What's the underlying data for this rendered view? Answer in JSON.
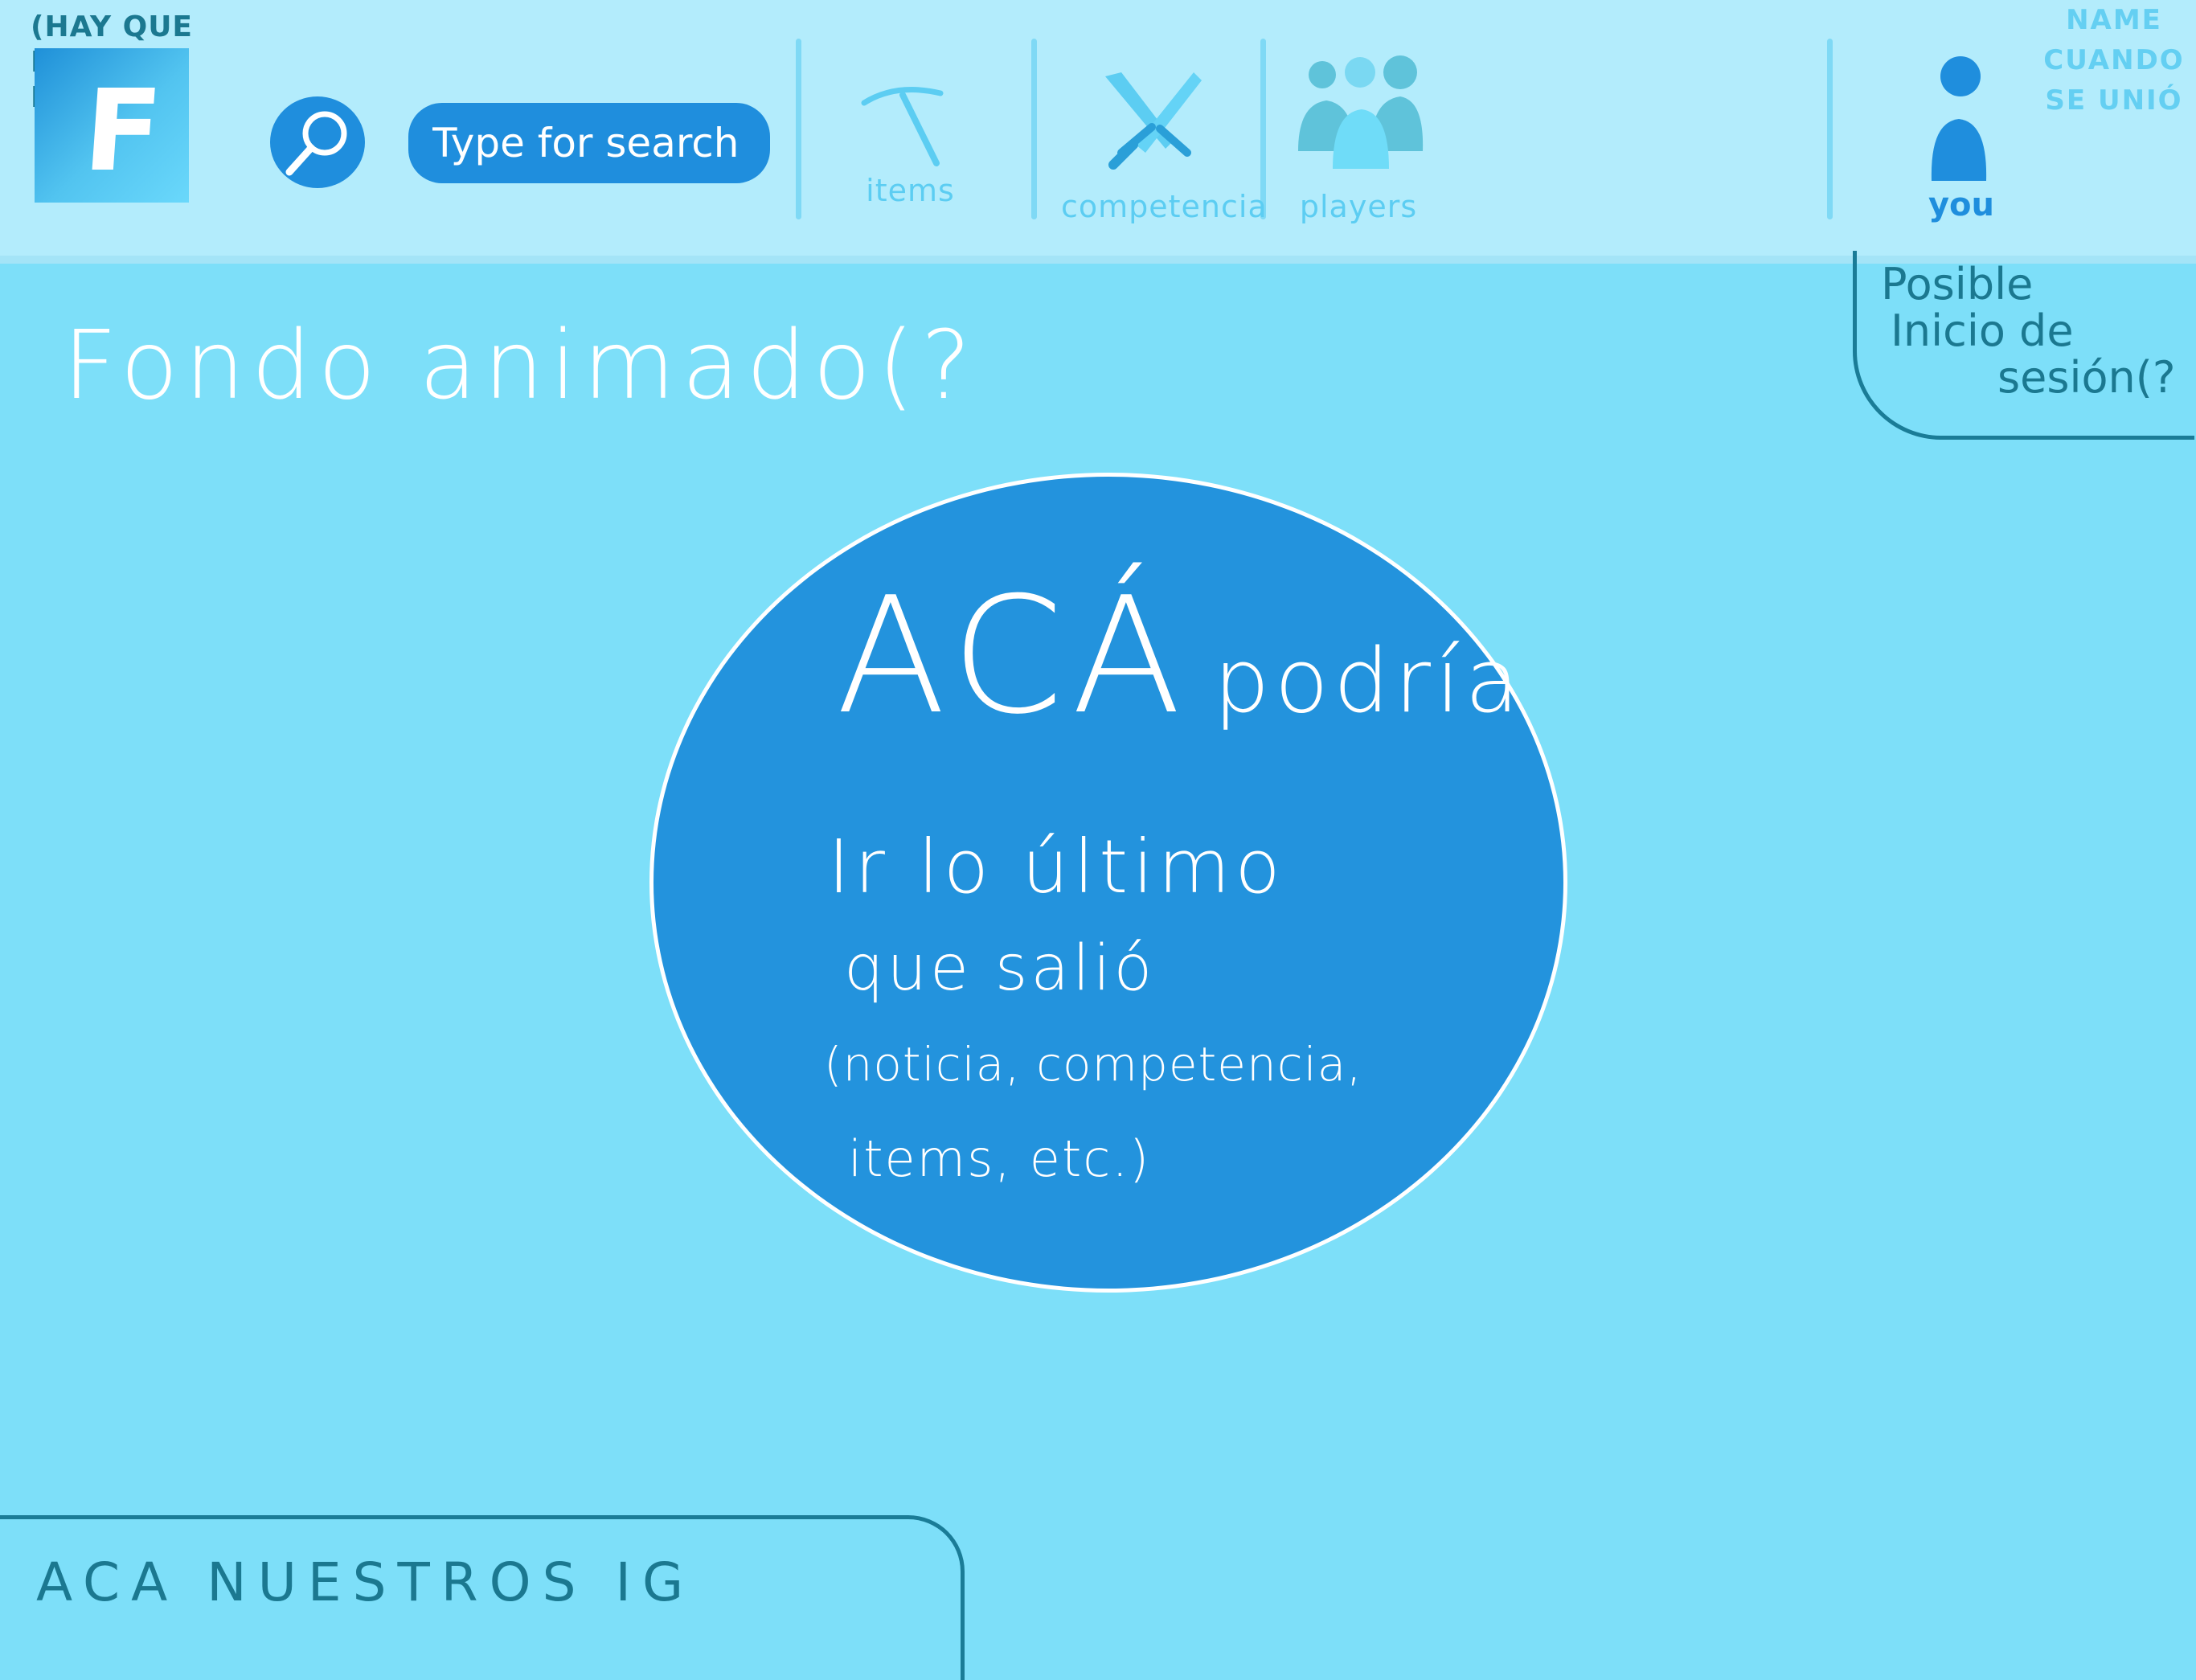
{
  "header": {
    "logo_note": "(HAY QUE HACER LOGO)",
    "logo_letter": "F",
    "search": {
      "placeholder": "Type for search",
      "icon": "magnifier-icon"
    },
    "nav": [
      {
        "label": "items",
        "icon": "pickaxe-icon"
      },
      {
        "label": "competencia",
        "icon": "crossed-swords-icon"
      },
      {
        "label": "players",
        "icon": "group-icon"
      }
    ],
    "profile": {
      "label": "you",
      "icon": "user-icon",
      "notes": [
        "NAME",
        "CUANDO",
        "SE UNIÓ"
      ]
    }
  },
  "login_note": {
    "lines": [
      "Posible",
      "Inicio de",
      "sesión(?"
    ]
  },
  "background_note": "Fondo animado(?",
  "hero": {
    "title_big": "ACÁ",
    "title_rest": "podría",
    "lines": [
      "Ir lo último",
      "que salió",
      "(noticia, competencia,",
      "items, etc.)"
    ]
  },
  "footer_note": "ACA NUESTROS IG",
  "colors": {
    "page_bg": "#7ddff9",
    "header_bg": "#b3ecfc",
    "accent": "#1f8edd",
    "nav_icon": "#5ccdf2",
    "note_ink": "#1b7890"
  }
}
